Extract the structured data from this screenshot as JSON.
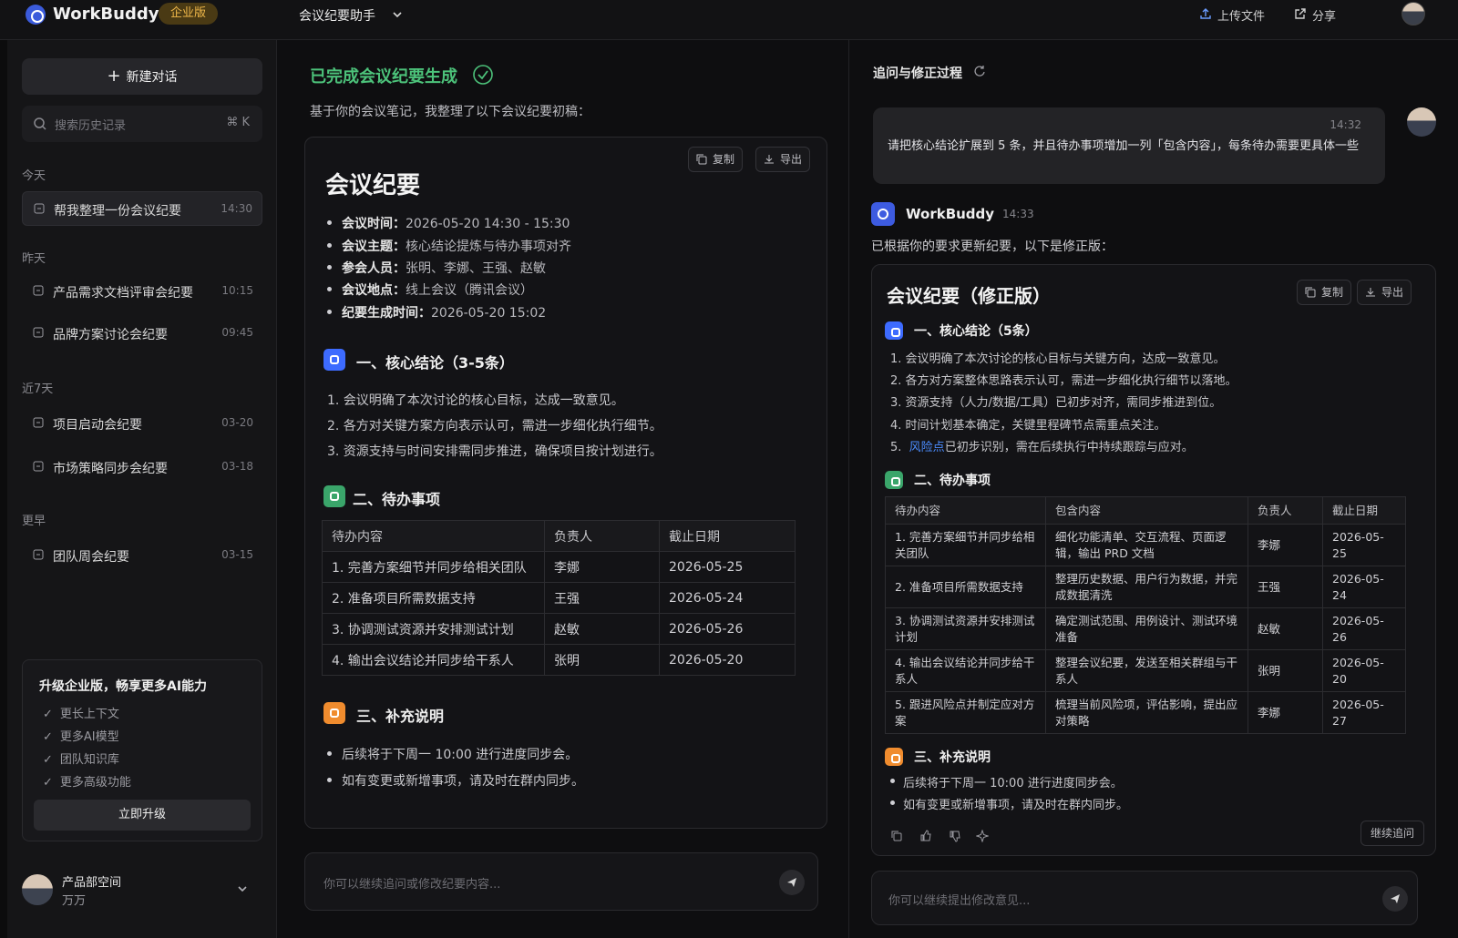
{
  "topbar": {
    "brand": "WorkBuddy",
    "edition_badge": "企业版",
    "assistant_selector": "会议纪要助手",
    "upload_label": "上传文件",
    "share_label": "分享"
  },
  "sidebar": {
    "new_chat_label": "新建对话",
    "search_placeholder": "搜索历史记录",
    "search_shortcut": "⌘ K",
    "groups": [
      {
        "label": "今天",
        "items": [
          {
            "title": "帮我整理一份会议纪要",
            "time": "14:30",
            "active": true
          }
        ]
      },
      {
        "label": "昨天",
        "items": [
          {
            "title": "产品需求文档评审会纪要",
            "time": "10:15"
          },
          {
            "title": "品牌方案讨论会纪要",
            "time": "09:45"
          }
        ]
      },
      {
        "label": "近7天",
        "items": [
          {
            "title": "项目启动会纪要",
            "time": "03-20"
          },
          {
            "title": "市场策略同步会纪要",
            "time": "03-18"
          }
        ]
      },
      {
        "label": "更早",
        "items": [
          {
            "title": "团队周会纪要",
            "time": "03-15"
          }
        ]
      }
    ],
    "upgrade": {
      "title": "升级企业版，畅享更多AI能力",
      "features": [
        "更长上下文",
        "更多AI模型",
        "团队知识库",
        "更多高级功能"
      ],
      "button_label": "立即升级"
    },
    "user": {
      "workspace": "产品部空间",
      "name": "万万"
    }
  },
  "middle": {
    "status_title": "已完成会议纪要生成",
    "intro": "基于你的会议笔记，我整理了以下会议纪要初稿：",
    "copy_label": "复制",
    "export_label": "导出",
    "doc_title": "会议纪要",
    "meta": [
      {
        "key": "会议时间：",
        "value": "2026-05-20 14:30 - 15:30"
      },
      {
        "key": "会议主题：",
        "value": "核心结论提炼与待办事项对齐"
      },
      {
        "key": "参会人员：",
        "value": "张明、李娜、王强、赵敏"
      },
      {
        "key": "会议地点：",
        "value": "线上会议（腾讯会议）"
      },
      {
        "key": "纪要生成时间：",
        "value": "2026-05-20 15:02"
      }
    ],
    "sections": {
      "conclusions_title": "一、核心结论（3-5条）",
      "conclusions": [
        "1.  会议明确了本次讨论的核心目标，达成一致意见。",
        "2.  各方对关键方案方向表示认可，需进一步细化执行细节。",
        "3.  资源支持与时间安排需同步推进，确保项目按计划进行。"
      ],
      "todo_title": "二、待办事项",
      "todo_headers": [
        "待办内容",
        "负责人",
        "截止日期"
      ],
      "todo_rows": [
        [
          "1. 完善方案细节并同步给相关团队",
          "李娜",
          "2026-05-25"
        ],
        [
          "2. 准备项目所需数据支持",
          "王强",
          "2026-05-24"
        ],
        [
          "3. 协调测试资源并安排测试计划",
          "赵敏",
          "2026-05-26"
        ],
        [
          "4. 输出会议结论并同步给干系人",
          "张明",
          "2026-05-20"
        ]
      ],
      "notes_title": "三、补充说明",
      "notes": [
        "后续将于下周一 10:00 进行进度同步会。",
        "如有变更或新增事项，请及时在群内同步。"
      ]
    },
    "input_placeholder": "你可以继续追问或修改纪要内容..."
  },
  "right": {
    "title": "追问与修正过程",
    "user_message": {
      "time": "14:32",
      "text": "请把核心结论扩展到 5 条，并且待办事项增加一列「包含内容」，每条待办需要更具体一些"
    },
    "bot": {
      "name": "WorkBuddy",
      "time": "14:33",
      "message": "已根据你的要求更新纪要，以下是修正版："
    },
    "copy_label": "复制",
    "export_label": "导出",
    "doc_title": "会议纪要（修正版）",
    "conclusions_title": "一、核心结论（5条）",
    "conclusions": [
      "1.  会议明确了本次讨论的核心目标与关键方向，达成一致意见。",
      "2.  各方对方案整体思路表示认可，需进一步细化执行细节以落地。",
      "3.  资源支持（人力/数据/工具）已初步对齐，需同步推进到位。",
      "4.  时间计划基本确定，关键里程碑节点需重点关注。"
    ],
    "conclusion5": {
      "num": "5.",
      "link": "风险点",
      "rest": "已初步识别，需在后续执行中持续跟踪与应对。"
    },
    "todo_title": "二、待办事项",
    "todo_headers": [
      "待办内容",
      "包含内容",
      "负责人",
      "截止日期"
    ],
    "todo_rows": [
      [
        "1. 完善方案细节并同步给相关团队",
        "细化功能清单、交互流程、页面逻辑，输出 PRD 文档",
        "李娜",
        "2026-05-25"
      ],
      [
        "2. 准备项目所需数据支持",
        "整理历史数据、用户行为数据，并完成数据清洗",
        "王强",
        "2026-05-24"
      ],
      [
        "3. 协调测试资源并安排测试计划",
        "确定测试范围、用例设计、测试环境准备",
        "赵敏",
        "2026-05-26"
      ],
      [
        "4. 输出会议结论并同步给干系人",
        "整理会议纪要，发送至相关群组与干系人",
        "张明",
        "2026-05-20"
      ],
      [
        "5. 跟进风险点并制定应对方案",
        "梳理当前风险项，评估影响，提出应对策略",
        "李娜",
        "2026-05-27"
      ]
    ],
    "notes_title": "三、补充说明",
    "notes": [
      "后续将于下周一 10:00 进行进度同步会。",
      "如有变更或新增事项，请及时在群内同步。"
    ],
    "continue_label": "继续追问",
    "input_placeholder": "你可以继续提出修改意见..."
  },
  "colors": {
    "accent_green": "#4cc27a",
    "accent_blue": "#3d5be0",
    "edition_gold": "#f0b84a"
  },
  "icons": [
    "plus-icon",
    "search-icon",
    "chat-icon",
    "check-icon",
    "upload-icon",
    "share-icon",
    "copy-icon",
    "download-icon",
    "send-icon",
    "refresh-icon",
    "thumbs-up-icon",
    "thumbs-down-icon",
    "sparkle-icon",
    "chevron-down-icon"
  ]
}
